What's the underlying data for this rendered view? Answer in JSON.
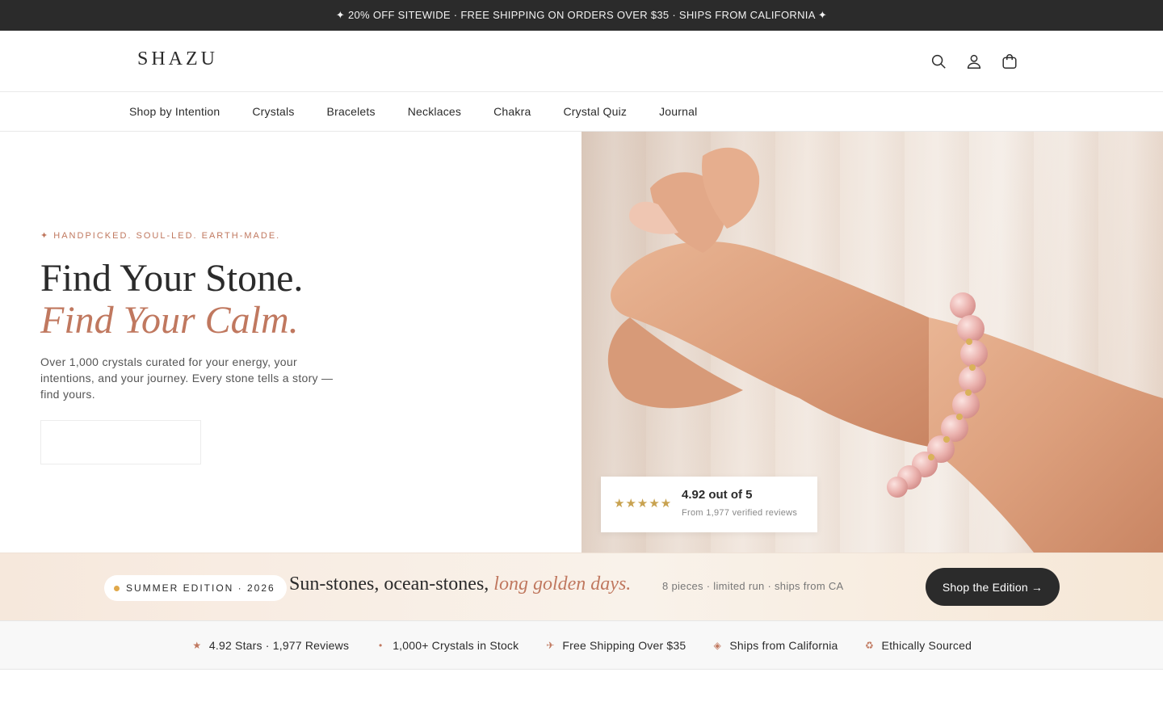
{
  "announcement": "✦ 20% OFF SITEWIDE · FREE SHIPPING ON ORDERS OVER $35 · SHIPS FROM CALIFORNIA ✦",
  "header": {
    "logo": "SHAZU",
    "icons": [
      "search-icon",
      "account-icon",
      "cart-icon"
    ]
  },
  "nav": {
    "items": [
      "Shop by Intention",
      "Crystals",
      "Bracelets",
      "Necklaces",
      "Chakra",
      "Crystal Quiz",
      "Journal"
    ]
  },
  "hero": {
    "eyebrow": "✦ HANDPICKED. SOUL-LED. EARTH-MADE.",
    "headline": "Find Your Stone.",
    "headline_accent": "Find Your Calm.",
    "description": "Over 1,000 crystals curated for your energy, your intentions, and your journey. Every stone tells a story — find yours.",
    "rating": {
      "stars": "★★★★★",
      "score": "4.92 out of 5",
      "subtext": "From 1,977 verified reviews"
    }
  },
  "edition": {
    "pill": "SUMMER EDITION · 2026",
    "headline_main": "Sun-stones, ocean-stones,",
    "headline_accent": "long golden days.",
    "meta": "8 pieces · limited run · ships from CA",
    "button": "Shop the Edition →"
  },
  "trust": {
    "items": [
      {
        "icon": "★",
        "label": "4.92 Stars · 1,977 Reviews"
      },
      {
        "icon": "•",
        "label": "1,000+ Crystals in Stock"
      },
      {
        "icon": "✈",
        "label": "Free Shipping Over $35"
      },
      {
        "icon": "◈",
        "label": "Ships from California"
      },
      {
        "icon": "♻",
        "label": "Ethically Sourced"
      }
    ]
  },
  "colors": {
    "dark": "#2b2b2b",
    "accent": "#c0785f",
    "star": "#c8a250"
  }
}
